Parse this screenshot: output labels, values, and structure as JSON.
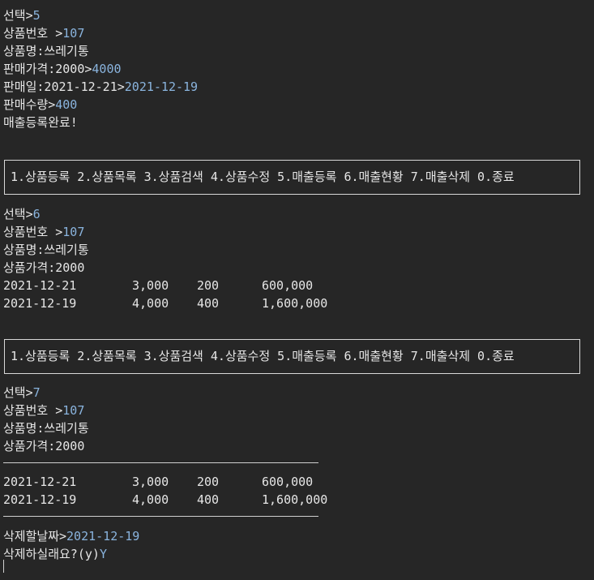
{
  "block1": {
    "select_label": "선택>",
    "select_value": "5",
    "product_no_label": "상품번호 >",
    "product_no_value": "107",
    "product_name_line": "상품명:쓰레기통",
    "sale_price_label": "판매가격:2000>",
    "sale_price_value": "4000",
    "sale_date_label": "판매일:2021-12-21>",
    "sale_date_value": "2021-12-19",
    "sale_qty_label": "판매수량>",
    "sale_qty_value": "400",
    "complete_msg": "매출등록완료!"
  },
  "menu": {
    "text": "1.상품등록 2.상품목록 3.상품검색 4.상품수정 5.매출등록 6.매출현황 7.매출삭제 0.종료"
  },
  "block2": {
    "select_label": "선택>",
    "select_value": "6",
    "product_no_label": "상품번호 >",
    "product_no_value": "107",
    "product_name_line": "상품명:쓰레기통",
    "price_line": "상품가격:2000",
    "rows": [
      {
        "date": "2021-12-21",
        "price": "3,000",
        "qty": "200",
        "total": "600,000"
      },
      {
        "date": "2021-12-19",
        "price": "4,000",
        "qty": "400",
        "total": "1,600,000"
      }
    ]
  },
  "block3": {
    "select_label": "선택>",
    "select_value": "7",
    "product_no_label": "상품번호 >",
    "product_no_value": "107",
    "product_name_line": "상품명:쓰레기통",
    "price_line": "상품가격:2000",
    "rows": [
      {
        "date": "2021-12-21",
        "price": "3,000",
        "qty": "200",
        "total": "600,000"
      },
      {
        "date": "2021-12-19",
        "price": "4,000",
        "qty": "400",
        "total": "1,600,000"
      }
    ],
    "delete_date_label": "삭제할날짜>",
    "delete_date_value": "2021-12-19",
    "confirm_label": "삭제하실래요?(y)",
    "confirm_value": "Y"
  }
}
